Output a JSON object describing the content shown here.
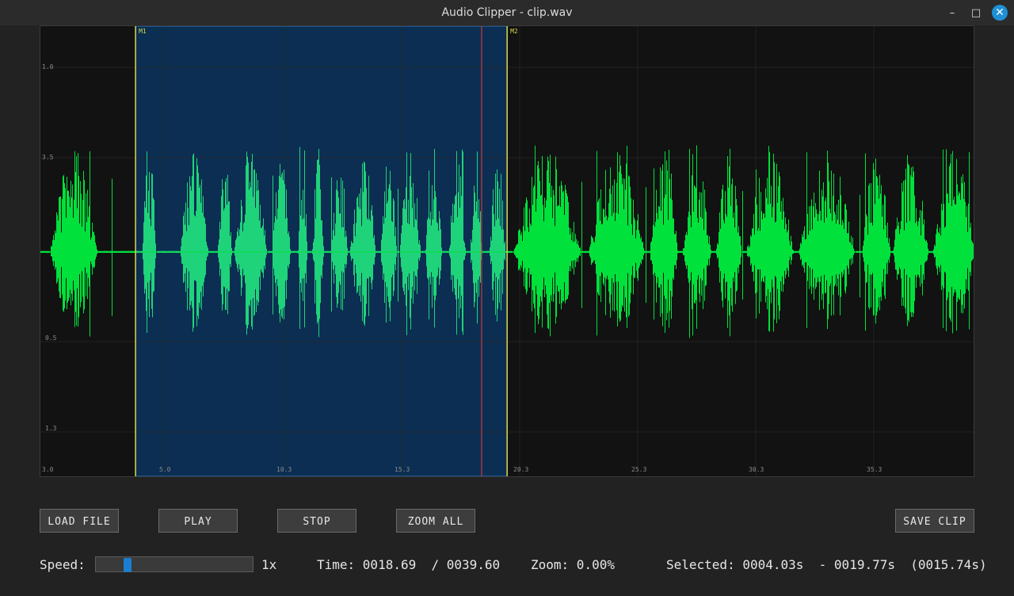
{
  "window": {
    "title": "Audio Clipper - clip.wav",
    "controls": {
      "minimize": "–",
      "maximize": "□",
      "close": "✕"
    }
  },
  "waveform": {
    "duration_s": 39.6,
    "selection_start_s": 4.03,
    "selection_end_s": 19.77,
    "playhead_s": 18.69,
    "markers": [
      "M1",
      "M2"
    ],
    "x_tick_labels": [
      "5.0",
      "10.3",
      "15.3",
      "20.3",
      "25.3",
      "30.3",
      "35.3"
    ],
    "y_tick_labels": [
      "1.0",
      "3.5",
      "0.5",
      "1.3",
      "3.0"
    ],
    "colors": {
      "background": "#121212",
      "selection": "#0c2e52",
      "selection_border": "#2a7fd4",
      "waveform": "#00e13c",
      "waveform_selected": "#1fd37a",
      "marker": "#d8d84a",
      "playhead": "#c83a3a"
    }
  },
  "buttons": {
    "load": "LOAD FILE",
    "play": "PLAY",
    "stop": "STOP",
    "zoom_all": "ZOOM ALL",
    "save_clip": "SAVE CLIP"
  },
  "status": {
    "speed_label": "Speed:",
    "speed_value": "1x",
    "speed_level": 0.2,
    "time_text": "Time: 0018.69  / 0039.60",
    "zoom_text": "Zoom: 0.00%",
    "selected_text": "Selected: 0004.03s  - 0019.77s  (0015.74s)"
  }
}
